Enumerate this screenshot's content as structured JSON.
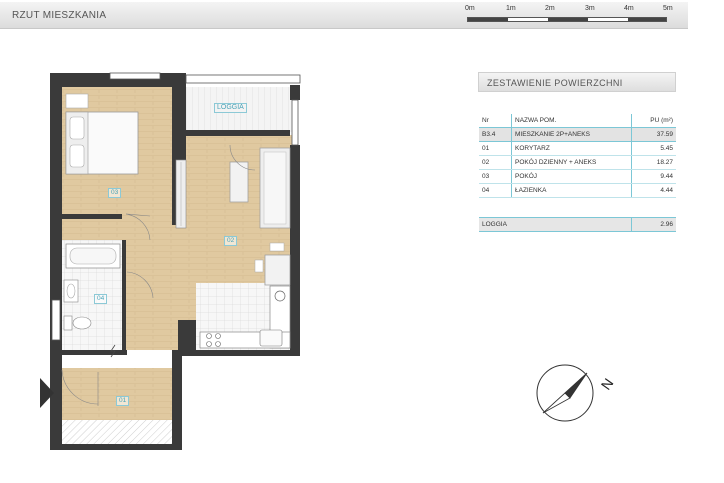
{
  "header": {
    "title": "RZUT MIESZKANIA",
    "scale_labels": [
      "0m",
      "1m",
      "2m",
      "3m",
      "4m",
      "5m"
    ]
  },
  "summary": {
    "title": "ZESTAWIENIE POWIERZCHNI",
    "columns": {
      "nr": "Nr",
      "name": "NAZWA POM.",
      "area": "PU (m²)"
    },
    "apartment": {
      "nr": "B3.4",
      "name": "MIESZKANIE 2P+ANEKS",
      "area": "37.59"
    },
    "rooms": [
      {
        "nr": "01",
        "name": "KORYTARZ",
        "area": "5.45"
      },
      {
        "nr": "02",
        "name": "POKÓJ DZIENNY + ANEKS",
        "area": "18.27"
      },
      {
        "nr": "03",
        "name": "POKÓJ",
        "area": "9.44"
      },
      {
        "nr": "04",
        "name": "ŁAZIENKA",
        "area": "4.44"
      }
    ],
    "loggia": {
      "name": "LOGGIA",
      "area": "2.96"
    }
  },
  "plan": {
    "loggia_label": "LOGGIA",
    "room_labels": {
      "r01": "01",
      "r02": "02",
      "r03": "03",
      "r04": "04"
    }
  },
  "compass": {
    "north_label": "N"
  },
  "colors": {
    "accent": "#7cc7d6",
    "wall": "#3a3a3a",
    "wood": "#dcc39a"
  }
}
